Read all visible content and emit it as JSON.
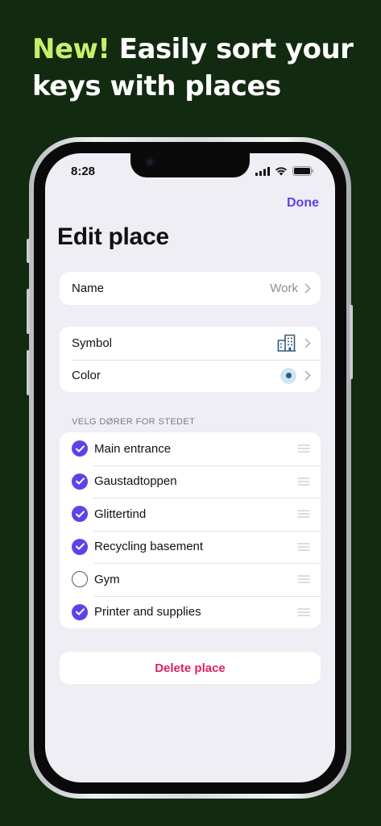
{
  "headline": {
    "accent": "New!",
    "rest": " Easily sort your keys with places"
  },
  "status": {
    "time": "8:28"
  },
  "nav": {
    "done_label": "Done"
  },
  "page": {
    "title": "Edit place"
  },
  "name_row": {
    "label": "Name",
    "value": "Work"
  },
  "symbol_row": {
    "label": "Symbol",
    "icon": "building-icon"
  },
  "color_row": {
    "label": "Color",
    "color": "#cfe6f2"
  },
  "doors_section": {
    "header": "VELG DØRER FOR STEDET",
    "items": [
      {
        "label": "Main entrance",
        "checked": true
      },
      {
        "label": "Gaustadtoppen",
        "checked": true
      },
      {
        "label": "Glittertind",
        "checked": true
      },
      {
        "label": "Recycling basement",
        "checked": true
      },
      {
        "label": "Gym",
        "checked": false
      },
      {
        "label": "Printer and supplies",
        "checked": true
      }
    ]
  },
  "delete": {
    "label": "Delete place"
  },
  "colors": {
    "accent": "#5b43e8",
    "destructive": "#e0215f",
    "background": "#122a10",
    "highlight": "#c6f06a"
  }
}
